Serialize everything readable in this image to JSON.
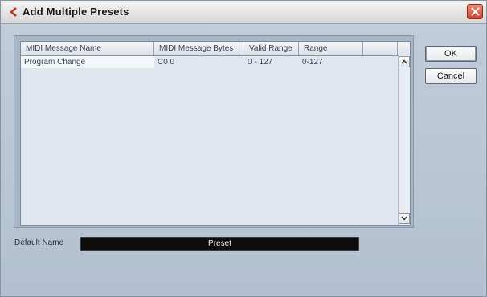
{
  "window": {
    "title": "Add Multiple Presets",
    "accent_color": "#c0392b"
  },
  "list": {
    "columns": [
      "MIDI Message Name",
      "MIDI Message Bytes",
      "Valid Range",
      "Range"
    ],
    "rows": [
      {
        "name": "Program Change",
        "bytes": "C0 0",
        "valid_range": "0 - 127",
        "range": "0-127",
        "selected": true
      }
    ]
  },
  "buttons": {
    "ok": "OK",
    "cancel": "Cancel"
  },
  "default_name": {
    "label": "Default Name",
    "value": "Preset"
  },
  "icons": {
    "app": "cubase-logo-icon",
    "close": "close-icon",
    "scroll_up": "chevron-up-icon",
    "scroll_down": "chevron-down-icon"
  }
}
